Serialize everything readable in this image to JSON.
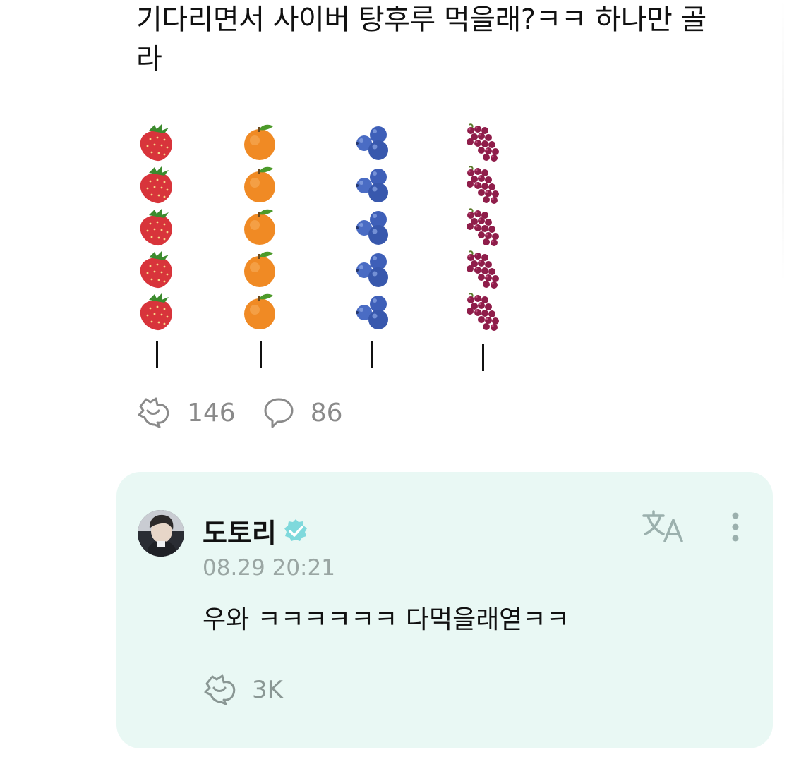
{
  "post": {
    "text": "기다리면서 사이버 탕후루 먹을래?ㅋㅋ 하나만 골라",
    "fruits": [
      "strawberry-icon",
      "orange-icon",
      "blueberry-icon",
      "grape-icon"
    ],
    "likes": "146",
    "comments": "86"
  },
  "comment": {
    "author": "도토리",
    "verified": true,
    "timestamp": "08.29 20:21",
    "text": "우와 ㅋㅋㅋㅋㅋㅋ 다먹을래엳ㅋㅋ",
    "likes": "3K",
    "accent_color": "#7fd9dc",
    "background_color": "#e9f8f4"
  }
}
